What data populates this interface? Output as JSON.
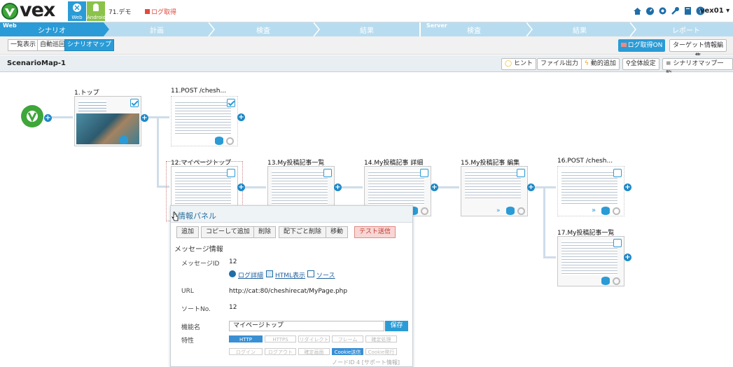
{
  "header": {
    "logo_text": "vex",
    "platform_web": "Web",
    "platform_android": "Android",
    "project_name": "71.デモ",
    "log_status": "ログ取得",
    "user": "vex01 ▾"
  },
  "phase_bar": {
    "web_label": "Web",
    "server_label": "Server",
    "web_steps": [
      "シナリオ",
      "計画",
      "検査",
      "結果"
    ],
    "server_steps": [
      "検査",
      "結果",
      "レポート"
    ]
  },
  "view_tabs": [
    "一覧表示",
    "自動巡回",
    "シナリオマップ"
  ],
  "toolbar": {
    "log_on": "ログ取得ON",
    "target_edit": "ターゲット情報編集"
  },
  "map": {
    "title": "ScenarioMap-1",
    "buttons": [
      "ヒント",
      "ファイル出力",
      "動的追加",
      "全体設定",
      "シナリオマップ一覧"
    ]
  },
  "nodes": [
    {
      "label": "1.トップ"
    },
    {
      "label": "11.POST /chesh..."
    },
    {
      "label": "12.マイページトップ"
    },
    {
      "label": "13.My投稿記事一覧"
    },
    {
      "label": "14.My投稿記事 詳細"
    },
    {
      "label": "15.My投稿記事 編集"
    },
    {
      "label": "16.POST /chesh..."
    },
    {
      "label": "17.My投稿記事一覧"
    }
  ],
  "panel": {
    "title": "情報パネル",
    "actions": [
      "追加",
      "コピーして追加",
      "削除",
      "配下ごと削除",
      "移動",
      "テスト送信"
    ],
    "section": "メッセージ情報",
    "message_id_label": "メッセージID",
    "message_id": "12",
    "links": [
      "ログ詳細",
      "HTML表示",
      "ソース"
    ],
    "url_label": "URL",
    "url": "http://cat:80/cheshirecat/MyPage.php",
    "sort_label": "ソートNo.",
    "sort_no": "12",
    "name_label": "機能名",
    "name_value": "マイページトップ",
    "save": "保存",
    "attr_label": "特性",
    "tags_row1": [
      "HTTP",
      "HTTPS",
      "リダイレクト",
      "フレーム",
      "確定処理"
    ],
    "tags_row2": [
      "ログイン",
      "ログアウト",
      "確定画面",
      "Cookie送信",
      "Cookie発行"
    ],
    "footer": "ノードID 4 [サポート情報]"
  }
}
